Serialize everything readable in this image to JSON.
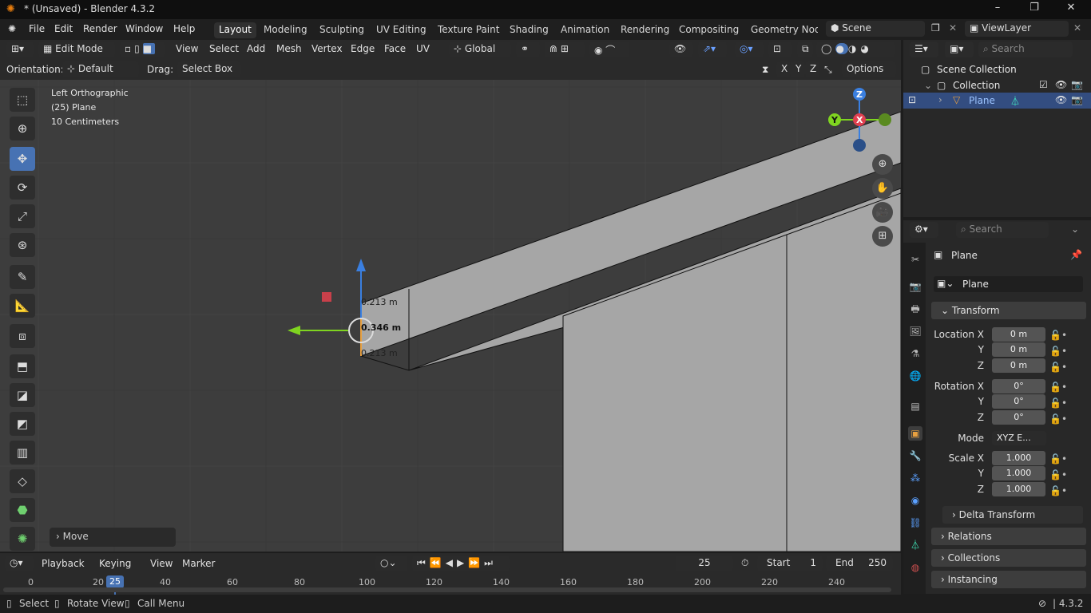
{
  "window": {
    "title": "* (Unsaved) - Blender 4.3.2",
    "min": "–",
    "max": "❐",
    "close": "✕"
  },
  "menu": {
    "file": "File",
    "edit": "Edit",
    "render": "Render",
    "window": "Window",
    "help": "Help"
  },
  "workspaces": [
    "Layout",
    "Modeling",
    "Sculpting",
    "UV Editing",
    "Texture Paint",
    "Shading",
    "Animation",
    "Rendering",
    "Compositing",
    "Geometry Node"
  ],
  "scene": {
    "name": "Scene",
    "viewlayer": "ViewLayer"
  },
  "header": {
    "mode": "Edit Mode",
    "view": "View",
    "select": "Select",
    "add": "Add",
    "mesh": "Mesh",
    "vertex": "Vertex",
    "edge": "Edge",
    "face": "Face",
    "uv": "UV",
    "transform": "Global"
  },
  "header2": {
    "orientation_label": "Orientation:",
    "orientation_value": "Default",
    "drag_label": "Drag:",
    "drag_value": "Select Box",
    "options": "Options",
    "x": "X",
    "y": "Y",
    "z": "Z"
  },
  "viewport": {
    "view_name": "Left Orthographic",
    "object": "(25) Plane",
    "scale": "10 Centimeters",
    "dim1": "0.213 m",
    "dim2": "0.346 m",
    "dim3": "0.213 m",
    "last_op": "Move",
    "gizmo_z": "Z",
    "gizmo_y": "Y",
    "gizmo_x": "X"
  },
  "outliner": {
    "search_placeholder": "Search",
    "scene_collection": "Scene Collection",
    "collection": "Collection",
    "plane": "Plane"
  },
  "properties": {
    "search_placeholder": "Search",
    "object_name": "Plane",
    "data_name": "Plane",
    "transform": "Transform",
    "loc_label": "Location X",
    "rot_label": "Rotation X",
    "scale_label": "Scale X",
    "y": "Y",
    "z": "Z",
    "mode_label": "Mode",
    "loc": [
      "0 m",
      "0 m",
      "0 m"
    ],
    "rot": [
      "0°",
      "0°",
      "0°"
    ],
    "mode": "XYZ E...",
    "scale": [
      "1.000",
      "1.000",
      "1.000"
    ],
    "delta": "Delta Transform",
    "relations": "Relations",
    "collections": "Collections",
    "instancing": "Instancing"
  },
  "timeline": {
    "playback": "Playback",
    "keying": "Keying",
    "view": "View",
    "marker": "Marker",
    "current": "25",
    "start_label": "Start",
    "start": "1",
    "end_label": "End",
    "end": "250",
    "ticks": [
      "0",
      "20",
      "40",
      "60",
      "80",
      "100",
      "120",
      "140",
      "160",
      "180",
      "200",
      "220",
      "240"
    ],
    "marker_frame": "25"
  },
  "status": {
    "select": "Select",
    "rotate": "Rotate View",
    "call_menu": "Call Menu",
    "version": "4.3.2"
  },
  "colors": {
    "accent": "#4772b3",
    "active_tab": "#303030",
    "frame_marker": "#4772b3"
  }
}
